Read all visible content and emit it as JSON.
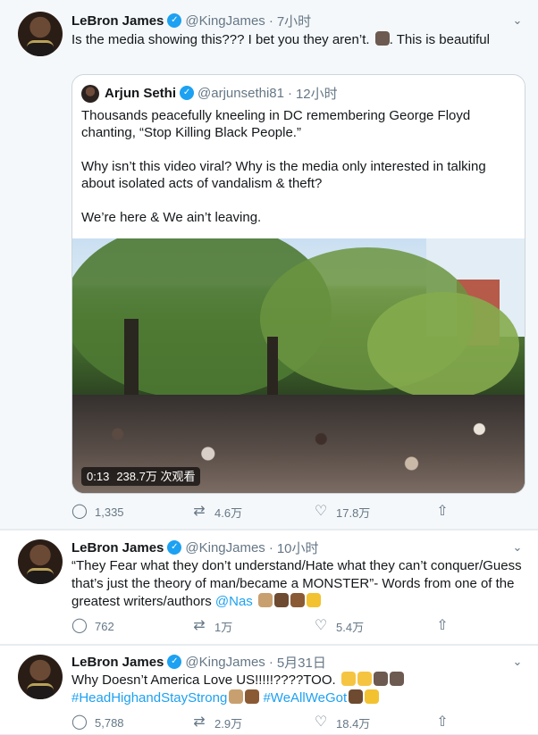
{
  "tweets": [
    {
      "author": "LeBron James",
      "verified_mark": "✓",
      "handle": "@KingJames",
      "time": "7小时",
      "text": "Is the media showing this??? I bet you they aren’t. ",
      "text_end": ". This is beautiful",
      "quote": {
        "author": "Arjun Sethi",
        "verified_mark": "✓",
        "handle": "@arjunsethi81",
        "time": "12小时",
        "paragraphs": [
          "Thousands peacefully kneeling in DC remembering George Floyd chanting, “Stop Killing Black People.”",
          "Why isn’t this video viral? Why is the media only interested in talking about isolated acts of vandalism & theft?",
          "We’re here & We ain’t leaving."
        ],
        "video": {
          "duration": "0:13",
          "views": "238.7万 次观看"
        }
      },
      "actions": {
        "replies": "1,335",
        "retweets": "4.6万",
        "likes": "17.8万"
      }
    },
    {
      "author": "LeBron James",
      "verified_mark": "✓",
      "handle": "@KingJames",
      "time": "10小时",
      "text": "“They Fear what they don’t understand/Hate what they can’t conquer/Guess that’s just the theory of man/became a MONSTER”- Words from one of the greatest writers/authors ",
      "mention": "@Nas",
      "actions": {
        "replies": "762",
        "retweets": "1万",
        "likes": "5.4万"
      }
    },
    {
      "author": "LeBron James",
      "verified_mark": "✓",
      "handle": "@KingJames",
      "time": "5月31日",
      "text": "Why Doesn’t America Love US!!!!!????TOO. ",
      "hashtag1": "#HeadHighandStayStrong",
      "hashtag2": "#WeAllWeGot",
      "actions": {
        "replies": "5,788",
        "retweets": "2.9万",
        "likes": "18.4万"
      }
    }
  ],
  "icons": {
    "chevron": "chevron-down-icon",
    "reply": "reply-icon",
    "retweet": "retweet-icon",
    "like": "heart-icon",
    "share": "share-icon"
  },
  "colors": {
    "accent": "#1da1f2",
    "muted": "#657786",
    "text": "#14171a"
  },
  "glyphs": {
    "chevron": "⌄",
    "reply": "◯",
    "retweet": "⇄",
    "like": "♡",
    "share": "⇧",
    "dot": "·"
  }
}
